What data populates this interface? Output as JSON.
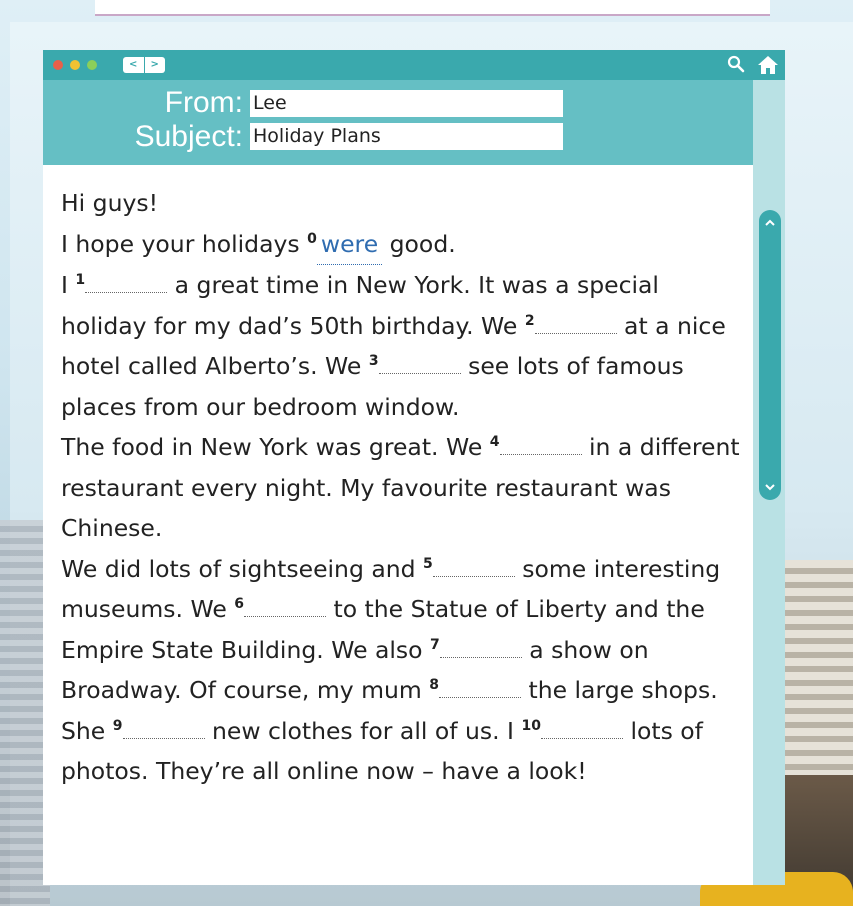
{
  "window": {
    "nav_back": "<",
    "nav_forward": ">",
    "icons": [
      "search-icon",
      "home-icon"
    ],
    "accent": "#3aa9ad"
  },
  "email": {
    "from_label": "From:",
    "from_value": "Lee",
    "subject_label": "Subject:",
    "subject_value": "Holiday Plans"
  },
  "body": {
    "greeting": "Hi guys!",
    "p1_before": "I hope your holidays",
    "n0": "0",
    "answer0": "were",
    "p1_after": "good.",
    "p2_a": "I",
    "n1": "1",
    "p2_b": "a great time in New York. It was a special holiday for my dad’s 50th birthday. We",
    "n2": "2",
    "p2_c": "at a nice hotel called Alberto’s. We",
    "n3": "3",
    "p2_d": "see lots of famous places from our bedroom window.",
    "p3_a": "The food in New York was great. We",
    "n4": "4",
    "p3_b": "in a different restaurant every night. My favourite restaurant was Chinese.",
    "p4_a": "We did lots of sightseeing and",
    "n5": "5",
    "p4_b": "some interesting museums. We",
    "n6": "6",
    "p4_c": "to the Statue of Liberty and the Empire State Building. We also",
    "n7": "7",
    "p4_d": "a show on Broadway. Of course, my mum",
    "n8": "8",
    "p4_e": "the large shops. She",
    "n9": "9",
    "p4_f": "new clothes for all of us. I",
    "n10": "10",
    "p4_g": "lots of photos. They’re all online now – have a look!"
  }
}
